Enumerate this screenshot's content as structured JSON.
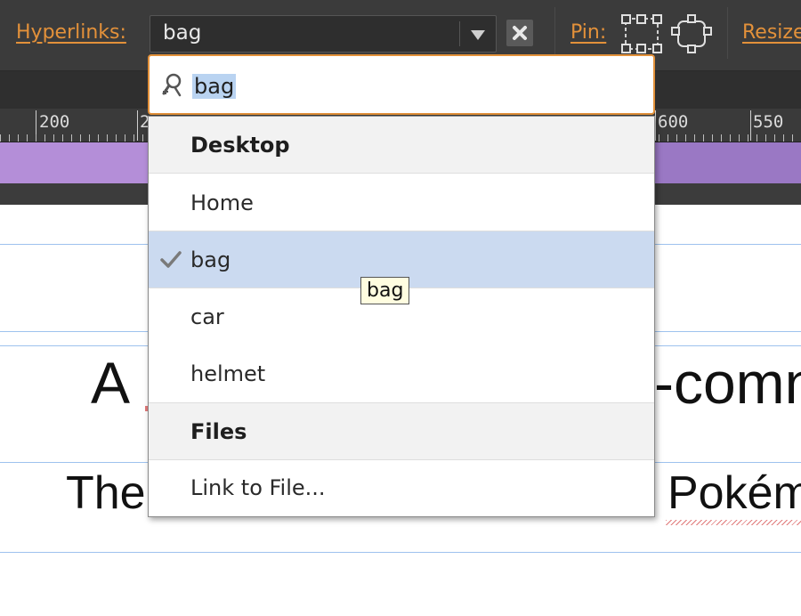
{
  "toolbar": {
    "hyperlinks_label": "Hyperlinks:",
    "hyperlinks_value": "bag",
    "pin_label": "Pin:",
    "resize_label": "Resize"
  },
  "ruler": {
    "labels": [
      "200",
      "2",
      "600",
      "550"
    ]
  },
  "canvas": {
    "heading_left": "A",
    "heading_right": "-comn",
    "para_left": "The",
    "para_right": "Pokém"
  },
  "dropdown": {
    "search_value": "bag",
    "sections": [
      {
        "header": "Desktop",
        "items": [
          "Home",
          "bag",
          "car",
          "helmet"
        ]
      },
      {
        "header": "Files",
        "items": [
          "Link to File..."
        ]
      }
    ],
    "selected_item": "bag",
    "tooltip": "bag"
  },
  "colors": {
    "accent": "#e3913a",
    "selection": "#cbdaf0",
    "breakpoint": "#b48ed8"
  }
}
